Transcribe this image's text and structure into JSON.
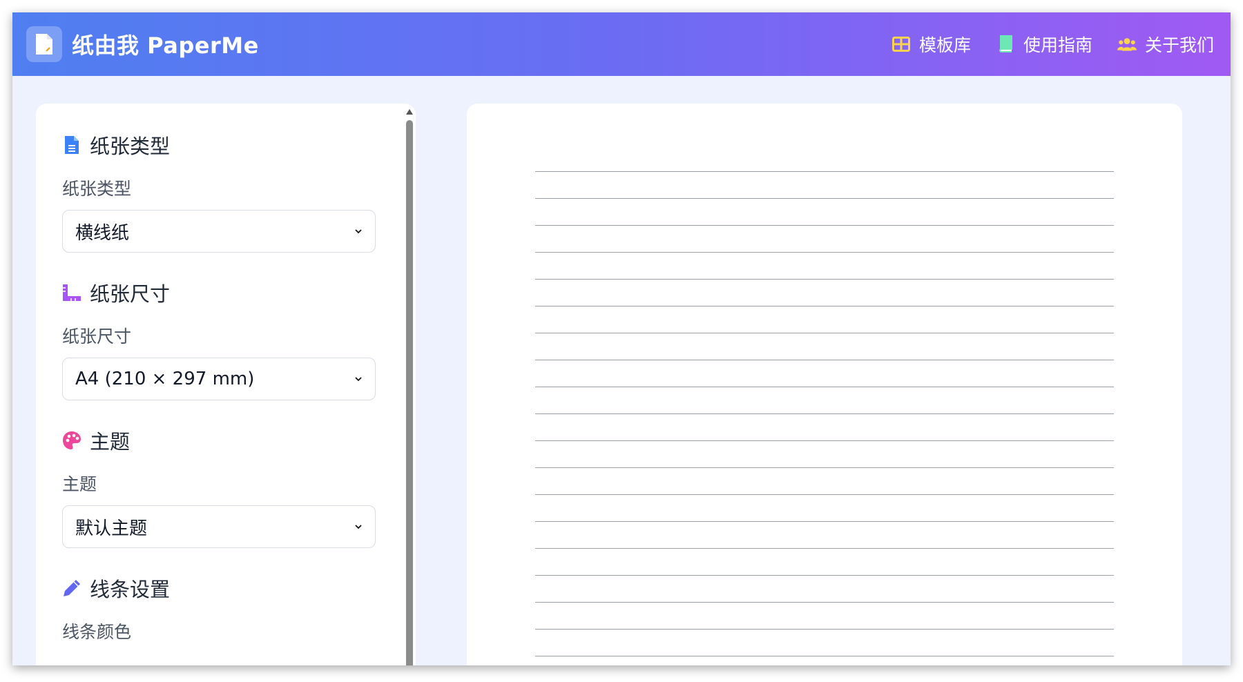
{
  "header": {
    "brand": "纸由我 PaperMe",
    "nav": [
      {
        "label": "模板库",
        "icon": "grid-table-icon",
        "color": "#fcd34d"
      },
      {
        "label": "使用指南",
        "icon": "book-icon",
        "color": "#6ee7b7"
      },
      {
        "label": "关于我们",
        "icon": "users-icon",
        "color": "#fcd34d"
      }
    ]
  },
  "sidebar": {
    "sections": [
      {
        "title": "纸张类型",
        "icon": "file-icon",
        "icon_color": "#3b82f6",
        "label": "纸张类型",
        "value": "横线纸"
      },
      {
        "title": "纸张尺寸",
        "icon": "ruler-icon",
        "icon_color": "#a855f7",
        "label": "纸张尺寸",
        "value": "A4 (210 × 297 mm)"
      },
      {
        "title": "主题",
        "icon": "palette-icon",
        "icon_color": "#ec4899",
        "label": "主题",
        "value": "默认主题"
      },
      {
        "title": "线条设置",
        "icon": "pencil-icon",
        "icon_color": "#6366f1",
        "label": "线条颜色"
      }
    ]
  },
  "preview": {
    "line_count": 19,
    "line_color": "#9aa0a6"
  }
}
